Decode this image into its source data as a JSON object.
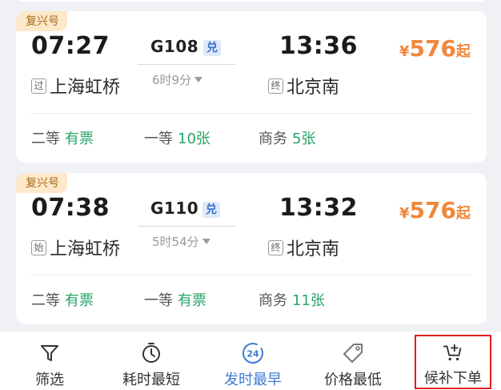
{
  "trains": [
    {
      "badge": "复兴号",
      "departure_time": "07:27",
      "train_no": "G108",
      "redeem_tag": "兑",
      "duration": "6时9分",
      "arrival_time": "13:36",
      "departure_tag": "过",
      "departure_station": "上海虹桥",
      "arrival_tag": "终",
      "arrival_station": "北京南",
      "price_symbol": "¥",
      "price": "576",
      "price_suffix": "起",
      "seats": [
        {
          "class": "二等",
          "availability": "有票"
        },
        {
          "class": "一等",
          "availability": "10张"
        },
        {
          "class": "商务",
          "availability": "5张"
        }
      ]
    },
    {
      "badge": "复兴号",
      "departure_time": "07:38",
      "train_no": "G110",
      "redeem_tag": "兑",
      "duration": "5时54分",
      "arrival_time": "13:32",
      "departure_tag": "始",
      "departure_station": "上海虹桥",
      "arrival_tag": "终",
      "arrival_station": "北京南",
      "price_symbol": "¥",
      "price": "576",
      "price_suffix": "起",
      "seats": [
        {
          "class": "二等",
          "availability": "有票"
        },
        {
          "class": "一等",
          "availability": "有票"
        },
        {
          "class": "商务",
          "availability": "11张"
        }
      ]
    }
  ],
  "bottom_bar": {
    "filter": {
      "label": "筛选",
      "icon": "filter-icon"
    },
    "shortest_duration": {
      "label": "耗时最短",
      "icon": "stopwatch-icon"
    },
    "earliest_departure": {
      "label": "发时最早",
      "icon": "clock-24-icon",
      "icon_text": "24"
    },
    "lowest_price": {
      "label": "价格最低",
      "icon": "price-tag-icon"
    },
    "waitlist": {
      "label": "候补下单",
      "icon": "cart-plus-icon"
    }
  },
  "colors": {
    "accent": "#3d7bd4",
    "price": "#f0873a",
    "available": "#27a566",
    "badge_bg": "#fde8c9",
    "badge_text": "#a76a19",
    "highlight_border": "#e02020"
  }
}
